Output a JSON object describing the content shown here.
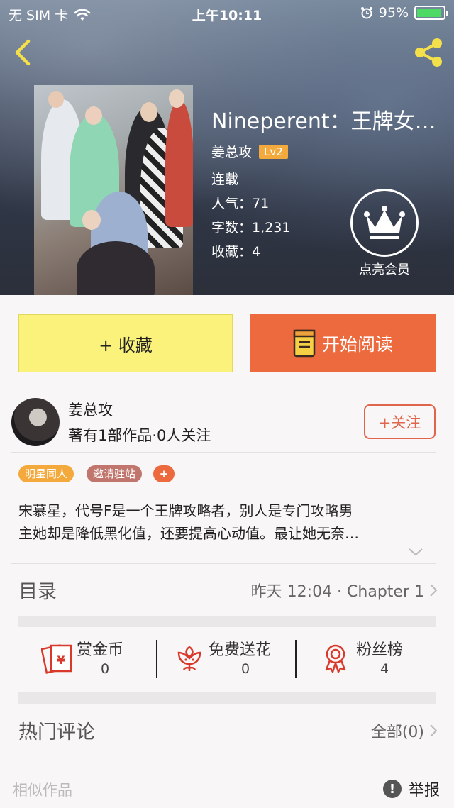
{
  "status_bar": {
    "carrier": "无 SIM 卡",
    "time": "上午10:11",
    "battery": "95%",
    "battery_level": 0.95
  },
  "book": {
    "title": "Nineperent：王牌女配…",
    "author": "姜总攻",
    "level": "Lv2",
    "status": "连载",
    "popularity_label": "人气：",
    "popularity": "71",
    "words_label": "字数：",
    "words": "1,231",
    "favorites_label": "收藏：",
    "favorites": "4"
  },
  "vip": {
    "label": "点亮会员"
  },
  "actions": {
    "collect": "+ 收藏",
    "read": "开始阅读"
  },
  "author_card": {
    "name": "姜总攻",
    "stats": "著有1部作品·0人关注",
    "follow": "+关注"
  },
  "tags": [
    "明星同人",
    "邀请驻站",
    "+"
  ],
  "description": {
    "line1": "宋慕星，代号F是一个王牌攻略者，别人是专门攻略男",
    "line2": "主她却是降低黑化值，还要提高心动值。最让她无奈…"
  },
  "catalog": {
    "title": "目录",
    "latest": "昨天 12:04 · Chapter 1"
  },
  "stats": [
    {
      "name": "赏金币",
      "value": "0",
      "icon": "red-envelope-icon"
    },
    {
      "name": "免费送花",
      "value": "0",
      "icon": "flower-icon"
    },
    {
      "name": "粉丝榜",
      "value": "4",
      "icon": "medal-icon"
    }
  ],
  "comments": {
    "title": "热门评论",
    "all": "全部(0)"
  },
  "footer": {
    "similar": "相似作品",
    "report": "举报"
  },
  "colors": {
    "accent_orange": "#ec6a3e",
    "collect_yellow": "#fbf27b",
    "badge_gold": "#f3a93c",
    "follow_red": "#e0654c",
    "icon_red": "#d8392b"
  }
}
